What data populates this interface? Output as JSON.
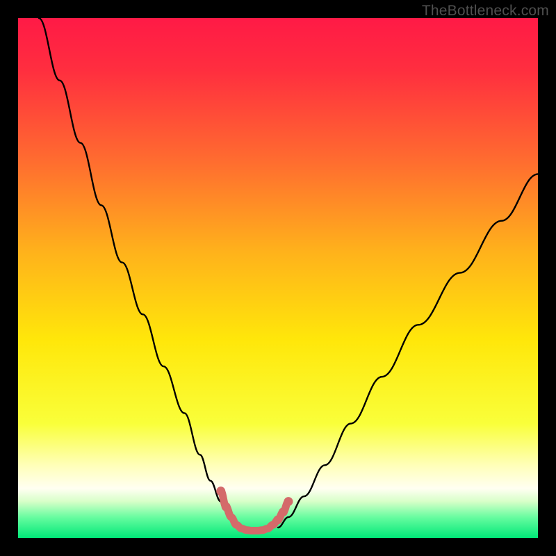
{
  "watermark": "TheBottleneck.com",
  "chart_data": {
    "type": "line",
    "title": "",
    "xlabel": "",
    "ylabel": "",
    "xlim": [
      0,
      100
    ],
    "ylim": [
      0,
      100
    ],
    "grid": false,
    "legend": false,
    "gradient_stops": [
      {
        "pos": 0.0,
        "color": "#ff1a46"
      },
      {
        "pos": 0.1,
        "color": "#ff2e3f"
      },
      {
        "pos": 0.28,
        "color": "#ff6e2f"
      },
      {
        "pos": 0.45,
        "color": "#ffb21b"
      },
      {
        "pos": 0.62,
        "color": "#ffe70a"
      },
      {
        "pos": 0.78,
        "color": "#f9ff3a"
      },
      {
        "pos": 0.86,
        "color": "#ffffb8"
      },
      {
        "pos": 0.905,
        "color": "#fffff2"
      },
      {
        "pos": 0.93,
        "color": "#d7ffc8"
      },
      {
        "pos": 0.96,
        "color": "#68fca0"
      },
      {
        "pos": 1.0,
        "color": "#00e878"
      }
    ],
    "series": [
      {
        "name": "left-curve",
        "color": "#000000",
        "x": [
          4,
          8,
          12,
          16,
          20,
          24,
          28,
          32,
          35,
          37,
          39,
          40.5,
          42
        ],
        "y": [
          100,
          88,
          76,
          64,
          53,
          43,
          33,
          24,
          16,
          11,
          7,
          4,
          2
        ]
      },
      {
        "name": "right-curve",
        "color": "#000000",
        "x": [
          50,
          52,
          55,
          59,
          64,
          70,
          77,
          85,
          93,
          100
        ],
        "y": [
          2,
          4,
          8,
          14,
          22,
          31,
          41,
          51,
          61,
          70
        ]
      },
      {
        "name": "trough-markers",
        "color": "#d46a6a",
        "type": "scatter",
        "x": [
          39,
          40,
          41,
          42,
          43,
          44,
          45,
          46,
          47,
          48,
          49,
          50,
          51,
          52
        ],
        "y": [
          9,
          6,
          4,
          2.5,
          1.8,
          1.5,
          1.4,
          1.4,
          1.5,
          1.8,
          2.5,
          3.5,
          5,
          7
        ]
      }
    ],
    "notes": "Values estimated from pixel positions; chart has no visible axis ticks or numeric labels."
  }
}
